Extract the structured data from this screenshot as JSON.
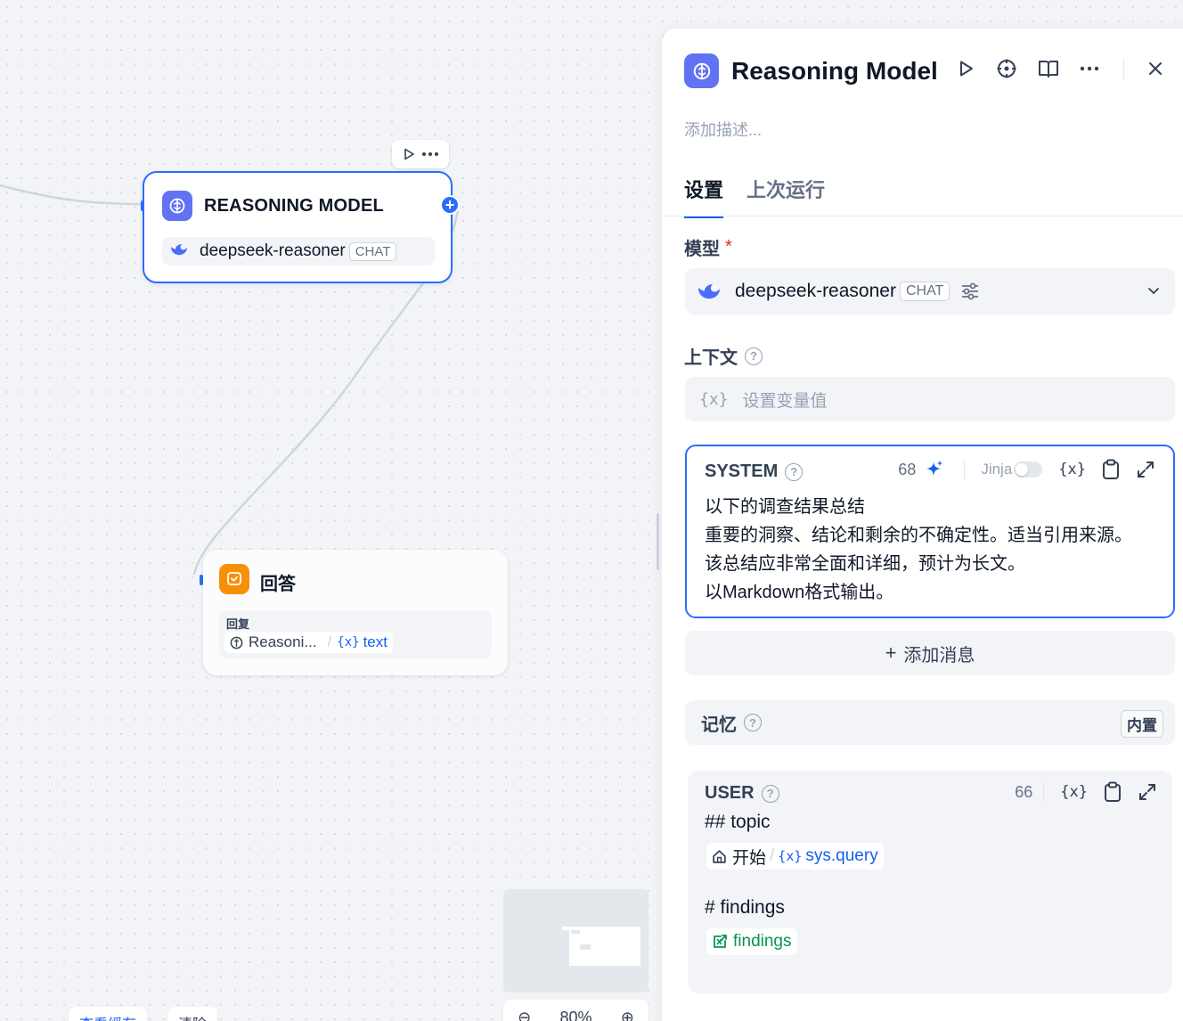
{
  "canvas": {
    "node_reasoning": {
      "title": "REASONING MODEL",
      "model": "deepseek-reasoner",
      "badge": "CHAT"
    },
    "node_answer": {
      "title": "回答",
      "field_label": "回复",
      "var_source": "Reasoni...",
      "var_name": "text"
    },
    "bottom": {
      "view_cache": "查看缓存",
      "clear": "清除",
      "zoom": "80%"
    }
  },
  "panel": {
    "title": "Reasoning Model",
    "description_placeholder": "添加描述...",
    "tabs": [
      "设置",
      "上次运行"
    ],
    "model": {
      "label": "模型",
      "required": "*",
      "name": "deepseek-reasoner",
      "badge": "CHAT"
    },
    "context": {
      "label": "上下文",
      "placeholder": "设置变量值"
    },
    "system": {
      "label": "SYSTEM",
      "count": "68",
      "jinja": "Jinja",
      "lines": [
        " 以下的调查结果总结",
        "重要的洞察、结论和剩余的不确定性。适当引用来源。",
        "该总结应非常全面和详细，预计为长文。",
        "以Markdown格式输出。"
      ]
    },
    "add_message": "添加消息",
    "memory": {
      "label": "记忆",
      "badge": "内置"
    },
    "user": {
      "label": "USER",
      "count": "66",
      "line1": "## topic",
      "var1_source": "开始",
      "var1_name": "sys.query",
      "line2": "# findings",
      "var2_name": "findings"
    }
  },
  "colors": {
    "accent": "#296dff",
    "node_icon": "#6172f3",
    "answer_icon": "#f79009"
  },
  "icons": [
    "run-icon",
    "target-icon",
    "book-icon",
    "more-icon",
    "close-icon",
    "sparkle-icon",
    "variable-icon",
    "clipboard-icon",
    "expand-icon",
    "tune-icon",
    "chevron-down-icon",
    "help-icon",
    "deepseek-icon",
    "home-icon",
    "loop-icon"
  ]
}
